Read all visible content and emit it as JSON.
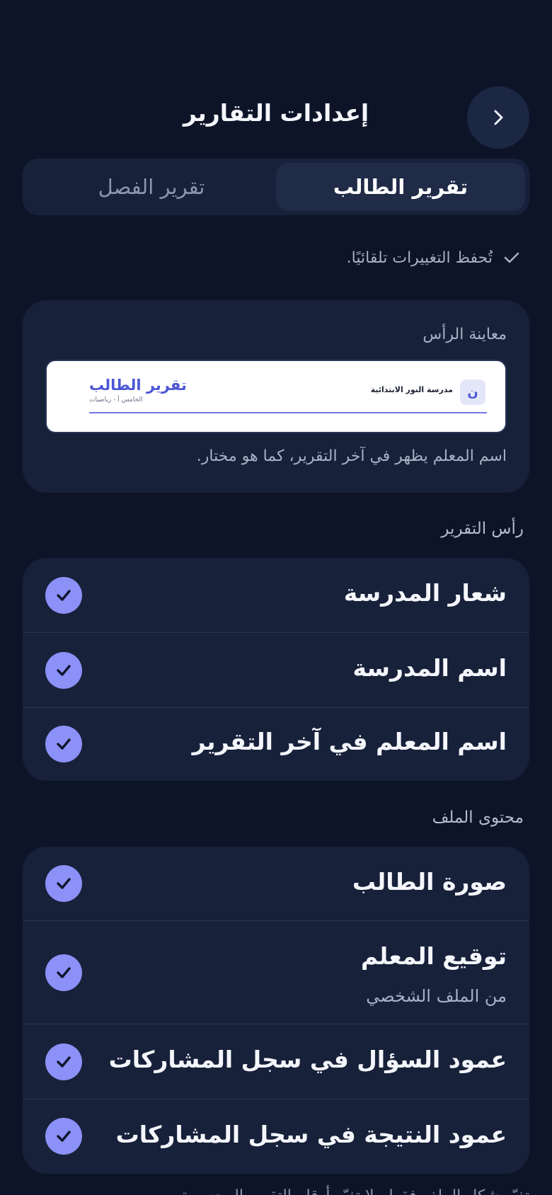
{
  "header": {
    "title": "إعدادات التقارير",
    "back_icon": "chevron-right-icon"
  },
  "tabs": [
    {
      "label": "تقرير الطالب",
      "active": true
    },
    {
      "label": "تقرير الفصل",
      "active": false
    }
  ],
  "autosave": {
    "text": "تُحفظ التغييرات تلقائيًا.",
    "icon": "checkmark-icon"
  },
  "preview": {
    "label": "معاينة الرأس",
    "logo_letter": "ن",
    "school_name": "مدرسة النور الابتدائية",
    "report_title": "تقرير الطالب",
    "subtitle": "الخامس أ - رياضيات",
    "caption": "اسم المعلم يظهر في آخر التقرير، كما هو مختار.",
    "accent_color": "#4c57d6"
  },
  "sections": {
    "header_section": {
      "label": "رأس التقرير",
      "items": [
        {
          "label": "شعار المدرسة",
          "checked": true
        },
        {
          "label": "اسم المدرسة",
          "checked": true
        },
        {
          "label": "اسم المعلم في آخر التقرير",
          "checked": true
        }
      ]
    },
    "content_section": {
      "label": "محتوى الملف",
      "items": [
        {
          "label": "صورة الطالب",
          "checked": true
        },
        {
          "label": "توقيع المعلم",
          "sublabel": "من الملف الشخصي",
          "checked": true
        },
        {
          "label": "عمود السؤال في سجل المشاركات",
          "checked": true
        },
        {
          "label": "عمود النتيجة في سجل المشاركات",
          "checked": true
        }
      ]
    }
  },
  "footer_note": "تغيّر شكل الملف فقط ولا تغيّر أرقام التقرير المحسوبة"
}
